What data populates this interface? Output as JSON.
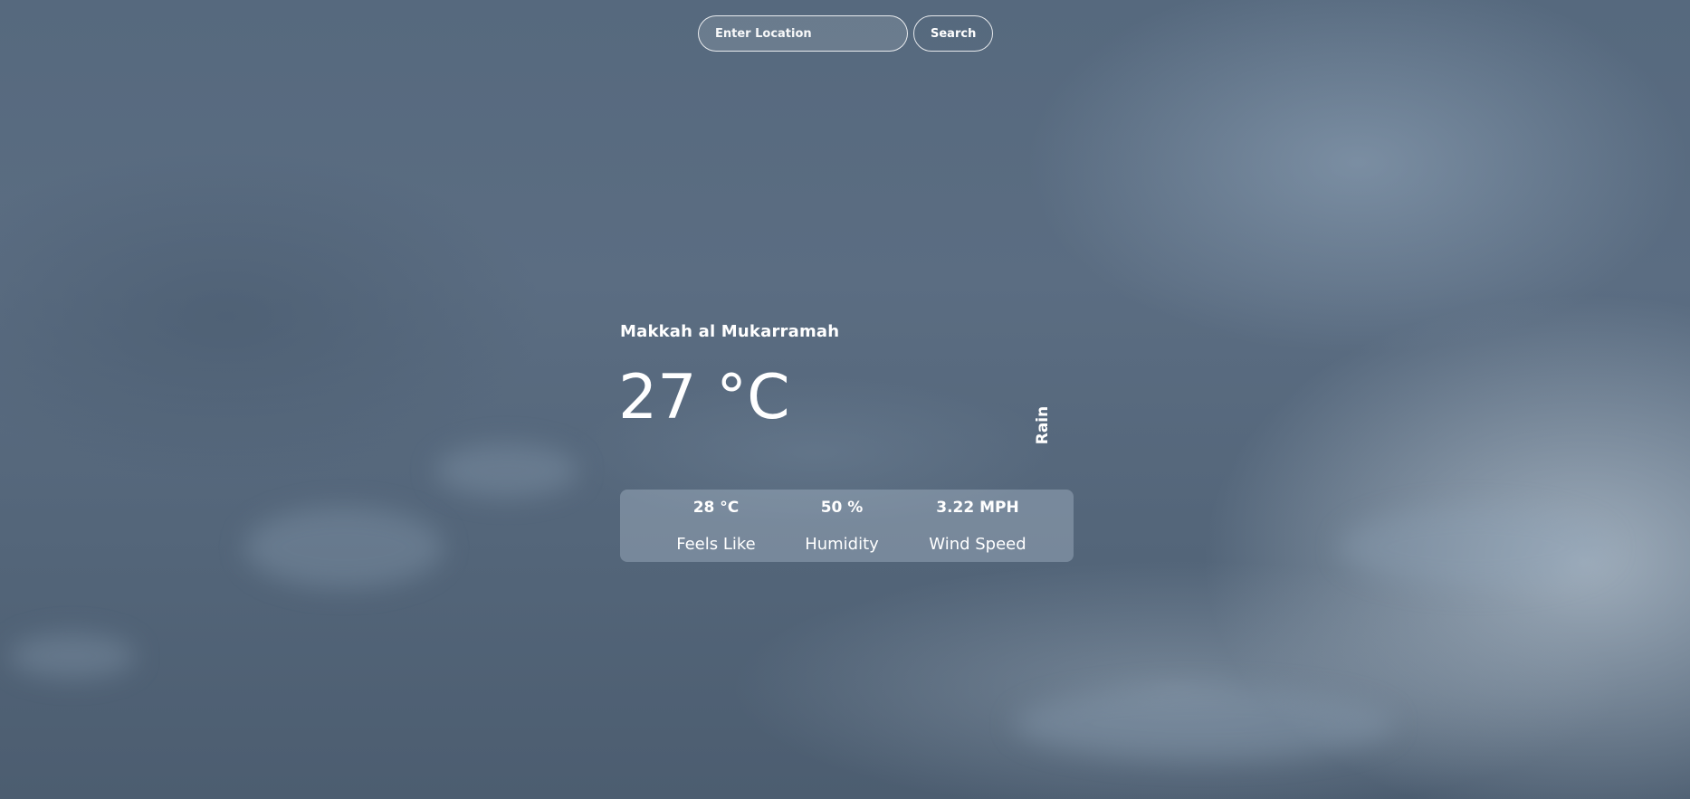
{
  "search": {
    "placeholder": "Enter Location",
    "button_label": "Search"
  },
  "weather": {
    "location": "Makkah al Mukarramah",
    "temperature": "27 °C",
    "condition": "Rain"
  },
  "stats": {
    "feels_like": {
      "value": "28 °C",
      "label": "Feels Like"
    },
    "humidity": {
      "value": "50 %",
      "label": "Humidity"
    },
    "wind_speed": {
      "value": "3.22 MPH",
      "label": "Wind Speed"
    }
  },
  "colors": {
    "background": "#56697e",
    "text": "#ffffff",
    "panel": "rgba(180,195,210,0.38)"
  }
}
